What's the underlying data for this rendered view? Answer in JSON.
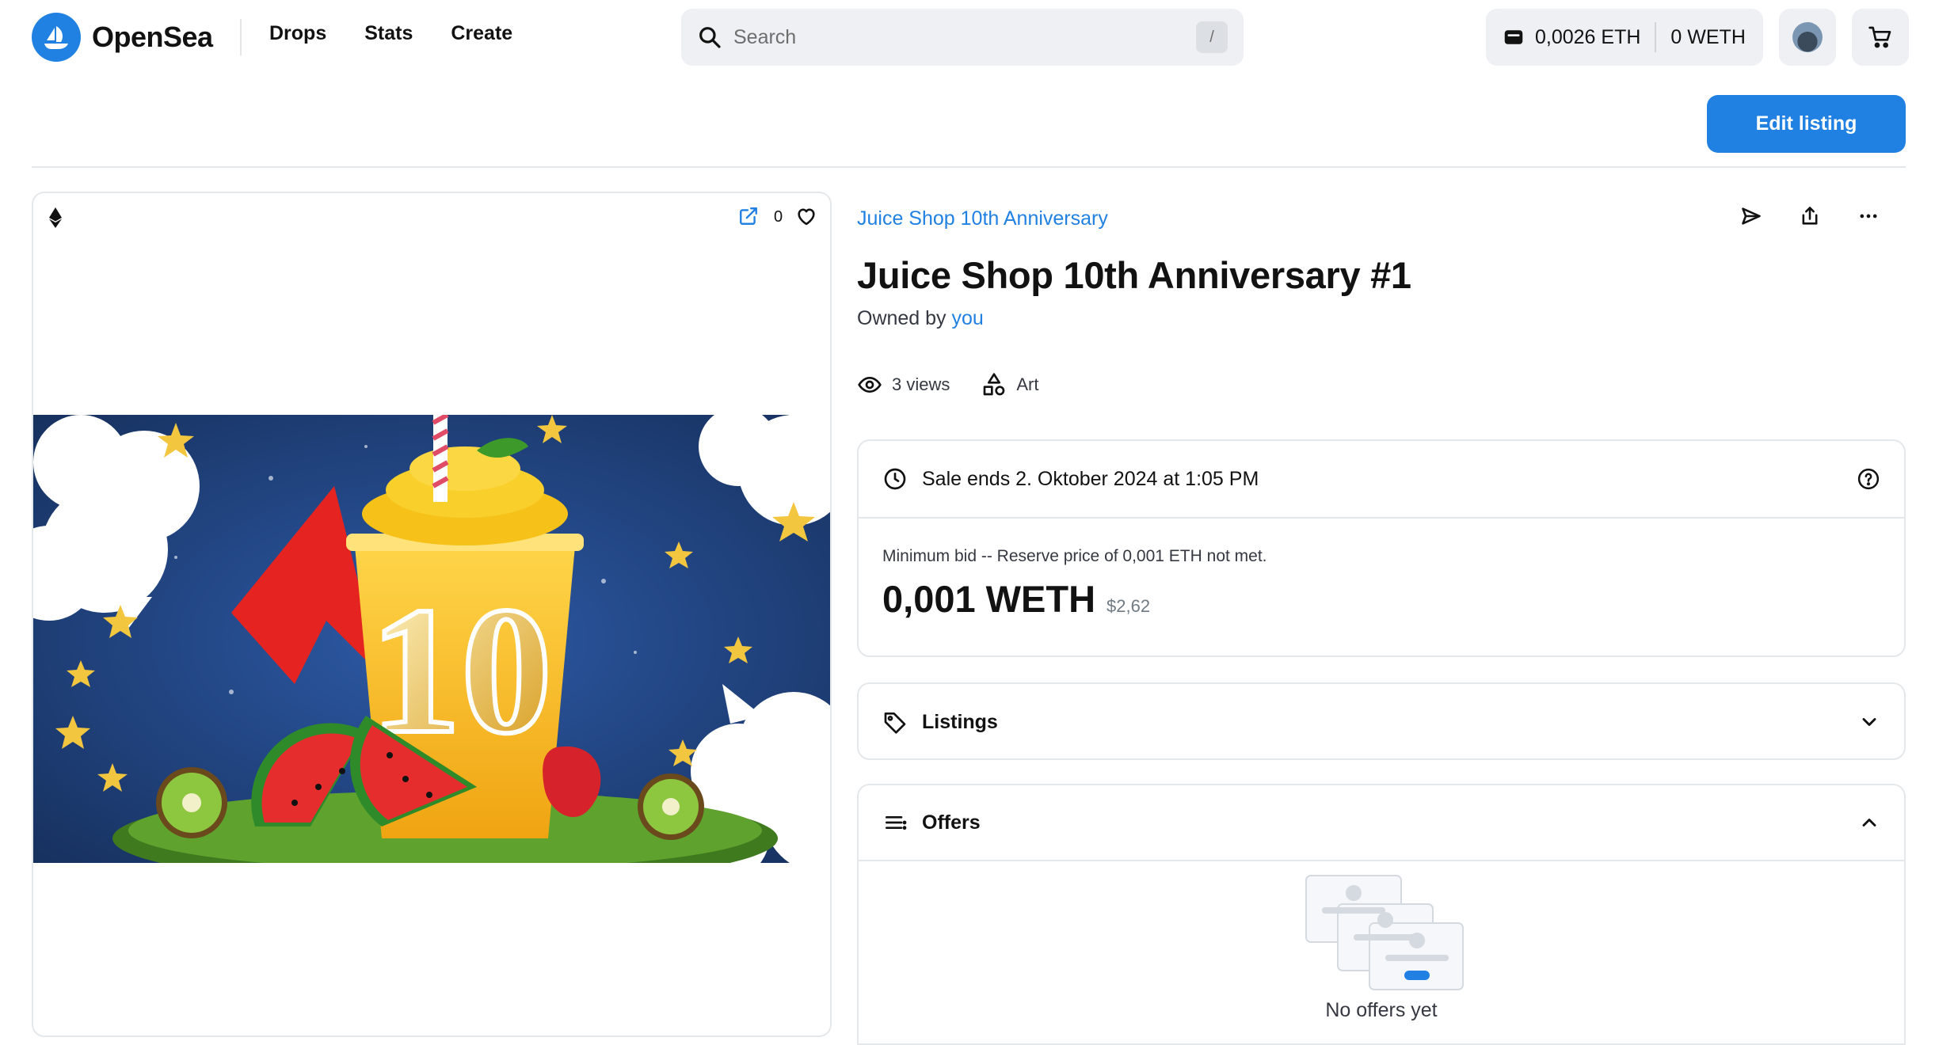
{
  "app": {
    "brand": "OpenSea"
  },
  "nav": {
    "links": [
      "Drops",
      "Stats",
      "Create"
    ]
  },
  "search": {
    "placeholder": "Search",
    "shortcut": "/"
  },
  "wallet": {
    "eth_balance": "0,0026 ETH",
    "weth_balance": "0 WETH"
  },
  "actions": {
    "edit_listing": "Edit listing"
  },
  "item": {
    "collection": "Juice Shop 10th Anniversary",
    "title": "Juice Shop 10th Anniversary #1",
    "owned_prefix": "Owned by",
    "owner": "you",
    "views": "3 views",
    "category": "Art",
    "favorites": "0"
  },
  "sale": {
    "ends": "Sale ends 2. Oktober 2024 at 1:05 PM",
    "min_bid_note": "Minimum bid -- Reserve price of 0,001 ETH not met.",
    "price": "0,001 WETH",
    "usd": "$2,62"
  },
  "sections": {
    "listings": "Listings",
    "offers": "Offers",
    "no_offers": "No offers yet"
  },
  "colors": {
    "accent": "#2081e2",
    "border": "#e5e8eb",
    "text": "#121212",
    "muted": "#707a83"
  },
  "icons": [
    "opensea-logo-icon",
    "search-icon",
    "wallet-icon",
    "cart-icon",
    "eth-icon",
    "external-link-icon",
    "heart-icon",
    "send-icon",
    "share-icon",
    "more-icon",
    "eye-icon",
    "shapes-icon",
    "clock-icon",
    "help-icon",
    "tag-icon",
    "chevron-down-icon",
    "list-icon",
    "chevron-up-icon"
  ]
}
